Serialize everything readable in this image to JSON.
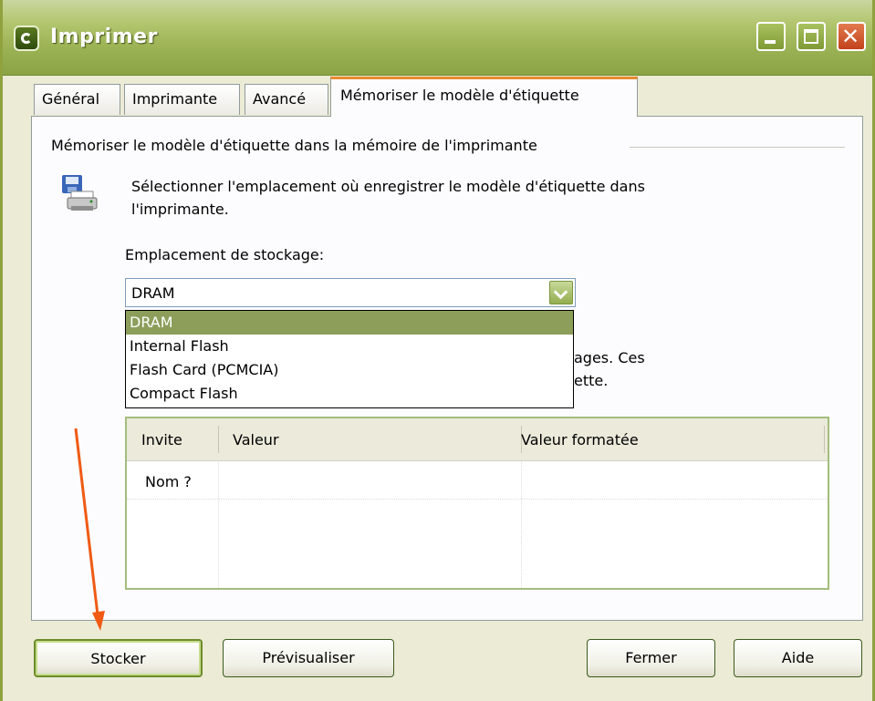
{
  "window": {
    "title": "Imprimer"
  },
  "tabs": [
    {
      "label": "Général"
    },
    {
      "label": "Imprimante"
    },
    {
      "label": "Avancé"
    },
    {
      "label": "Mémoriser  le modèle d'étiquette"
    }
  ],
  "panel": {
    "group_title": "Mémoriser le modèle d'étiquette dans la mémoire de l'imprimante",
    "description_line1": "Sélectionner l'emplacement où enregistrer le modèle d'étiquette dans",
    "description_line2": "l'imprimante.",
    "storage_label": "Emplacement de stockage:",
    "storage_selected": "DRAM",
    "storage_options": [
      "DRAM",
      "Internal Flash",
      "Flash Card (PCMCIA)",
      "Compact Flash"
    ],
    "partial_text_line1": "ages. Ces",
    "partial_text_line2": "ette."
  },
  "grid": {
    "columns": [
      "Invite",
      "Valeur",
      "Valeur formatée"
    ],
    "rows": [
      {
        "invite": "Nom ?",
        "valeur": "",
        "valeur_formatee": ""
      }
    ]
  },
  "buttons": {
    "store": "Stocker",
    "preview": "Prévisualiser",
    "close": "Fermer",
    "help": "Aide"
  },
  "annotation": {
    "arrow_color": "#f05a14"
  }
}
